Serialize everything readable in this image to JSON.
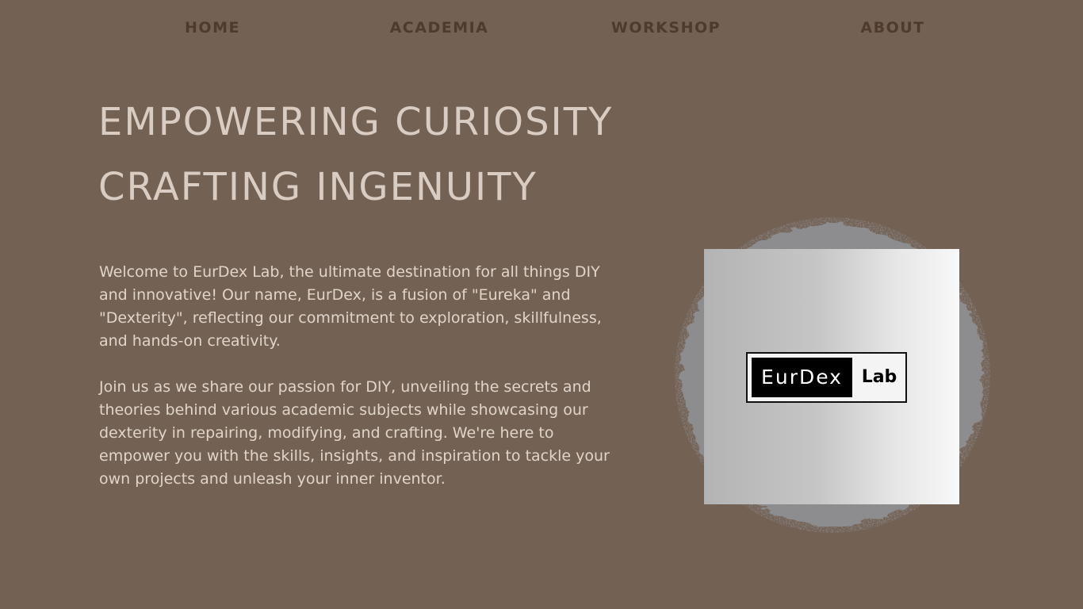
{
  "nav": {
    "items": [
      {
        "label": "HOME"
      },
      {
        "label": "ACADEMIA"
      },
      {
        "label": "WORKSHOP"
      },
      {
        "label": "ABOUT"
      }
    ]
  },
  "hero": {
    "headline_line1": "EMPOWERING CURIOSITY",
    "headline_line2": "CRAFTING INGENUITY",
    "paragraph1": "Welcome to EurDex Lab, the ultimate destination for all things DIY and innovative! Our name, EurDex, is a fusion of \"Eureka\" and \"Dexterity\", reflecting our commitment to exploration, skillfulness, and hands-on creativity.",
    "paragraph2": "Join us as we share our passion for DIY, unveiling the secrets and theories behind various academic subjects while showcasing our dexterity in repairing, modifying, and crafting. We're here to empower you with the skills, insights, and inspiration to tackle your own projects and unleash your inner inventor."
  },
  "logo": {
    "left_text": "EurDex",
    "right_text": "Lab"
  },
  "colors": {
    "background": "#736154",
    "nav_text": "#4f3b2d",
    "headline_text": "#d9ccc2",
    "body_text": "#e0d4c9",
    "brush": "#8d8c8e"
  }
}
